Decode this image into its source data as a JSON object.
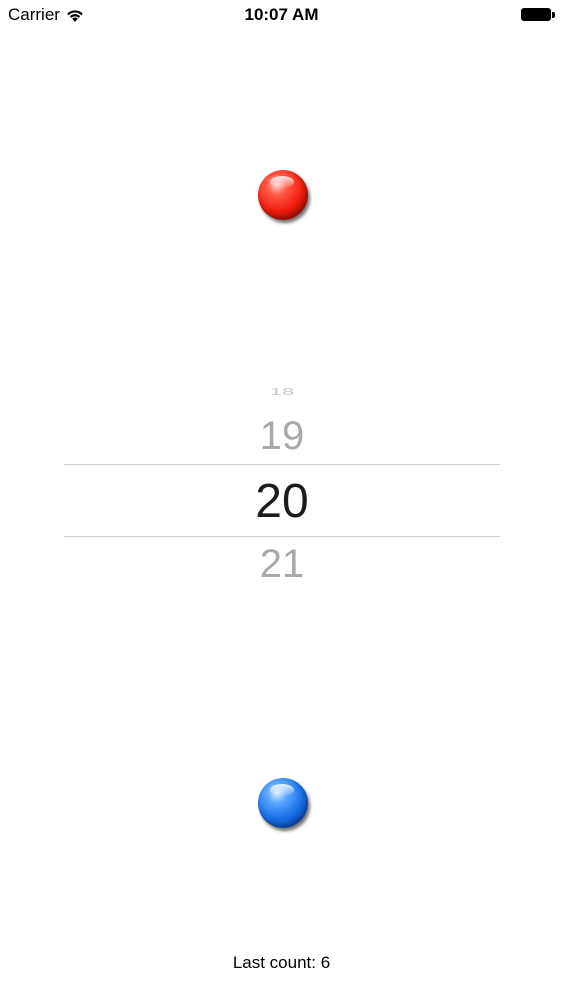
{
  "status_bar": {
    "carrier": "Carrier",
    "time": "10:07 AM",
    "wifi_icon": "wifi-icon",
    "battery_icon": "battery-icon"
  },
  "balls": {
    "top_color": "#f01e10",
    "bottom_color": "#1a6fe8"
  },
  "picker": {
    "far_top": "18",
    "previous": "19",
    "selected": "20",
    "next": "21"
  },
  "footer": {
    "last_count": "Last count: 6"
  }
}
